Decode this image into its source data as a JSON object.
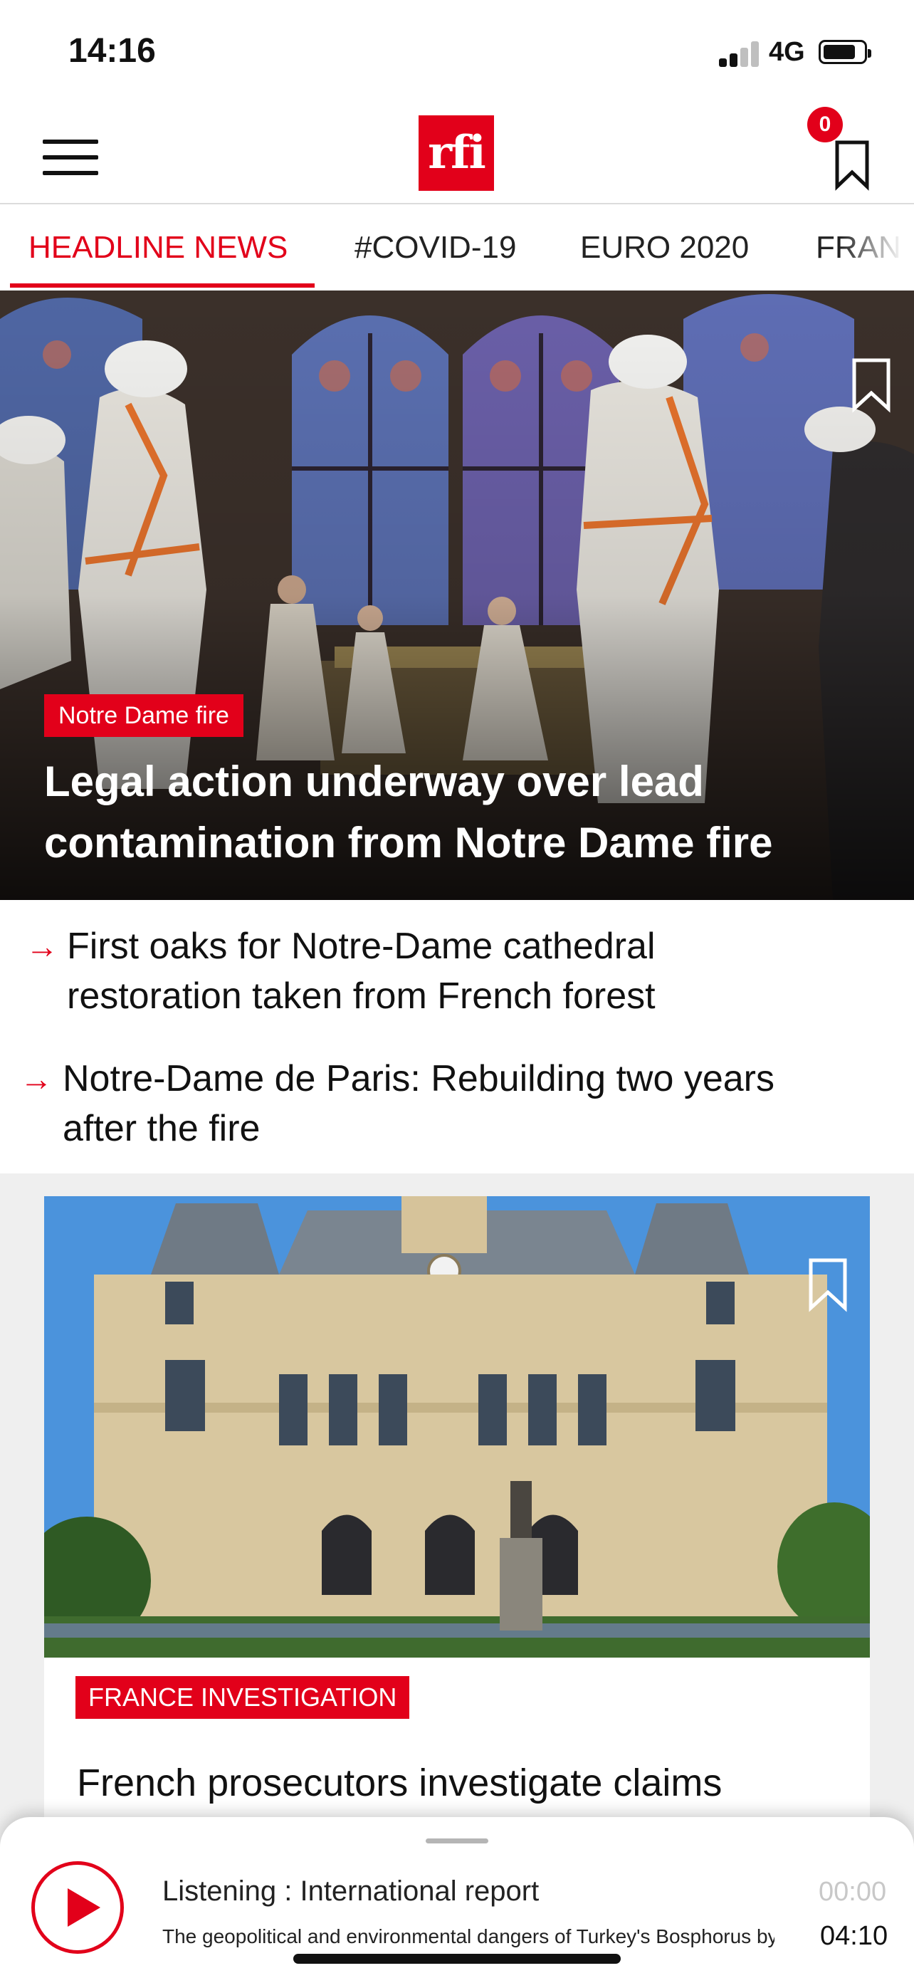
{
  "status_bar": {
    "time": "14:16",
    "network": "4G"
  },
  "header": {
    "logo_text": "rfi",
    "bookmark_count": "0"
  },
  "tabs": [
    {
      "label": "HEADLINE NEWS",
      "active": true
    },
    {
      "label": "#COVID-19"
    },
    {
      "label": "EURO 2020"
    },
    {
      "label": "FRAN"
    }
  ],
  "hero": {
    "tag": "Notre Dame fire",
    "title": "Legal action underway over lead contamination from Notre Dame fire"
  },
  "related": [
    {
      "line1": "First oaks for Notre-Dame cathedral",
      "line2": "restoration taken from French forest"
    },
    {
      "line1": "Notre-Dame de Paris: Rebuilding two years",
      "line2": "after the fire"
    }
  ],
  "card": {
    "tag": "FRANCE INVESTIGATION",
    "title": "French prosecutors investigate claims"
  },
  "player": {
    "listening": "Listening : International report",
    "subtitle": "The geopolitical and environmental dangers of Turkey's Bosphorus bypa...",
    "elapsed": "00:00",
    "duration": "04:10"
  },
  "colors": {
    "brand_red": "#e2001a"
  }
}
